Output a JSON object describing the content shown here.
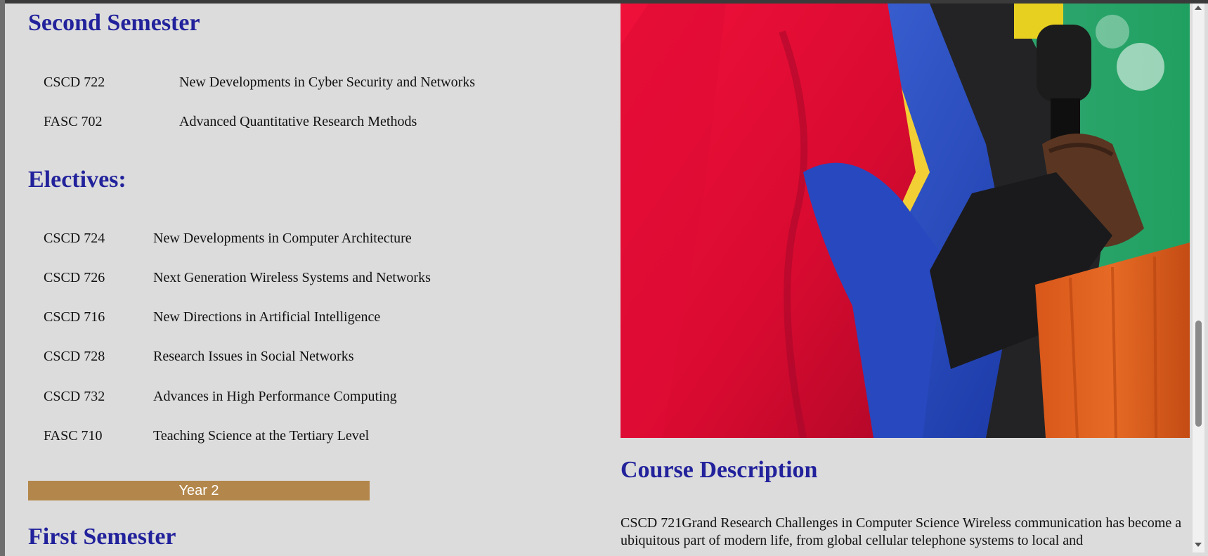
{
  "second_semester": {
    "heading": "Second Semester",
    "courses": [
      {
        "code": "CSCD 722",
        "title": "New Developments in Cyber Security and Networks"
      },
      {
        "code": "FASC 702",
        "title": "Advanced Quantitative Research Methods"
      }
    ]
  },
  "electives": {
    "heading": "Electives:",
    "courses": [
      {
        "code": "CSCD 724",
        "title": "New Developments in Computer Architecture"
      },
      {
        "code": "CSCD 726",
        "title": "Next Generation Wireless Systems and Networks"
      },
      {
        "code": "CSCD 716",
        "title": "New Directions in Artificial Intelligence"
      },
      {
        "code": "CSCD 728",
        "title": "Research Issues in Social Networks"
      },
      {
        "code": "CSCD 732",
        "title": "Advances in High Performance Computing"
      },
      {
        "code": "FASC 710",
        "title": "Teaching Science at the Tertiary Level"
      }
    ]
  },
  "year_bar": {
    "label": "Year 2"
  },
  "first_semester": {
    "heading": "First Semester"
  },
  "course_description": {
    "heading": "Course Description",
    "text": "CSCD 721Grand Research Challenges in Computer Science Wireless communication has become a ubiquitous part of modern life, from global cellular telephone systems to local and"
  },
  "colors": {
    "heading": "#22229c",
    "year_bar": "#b3874b",
    "background": "#dcdcdc"
  }
}
